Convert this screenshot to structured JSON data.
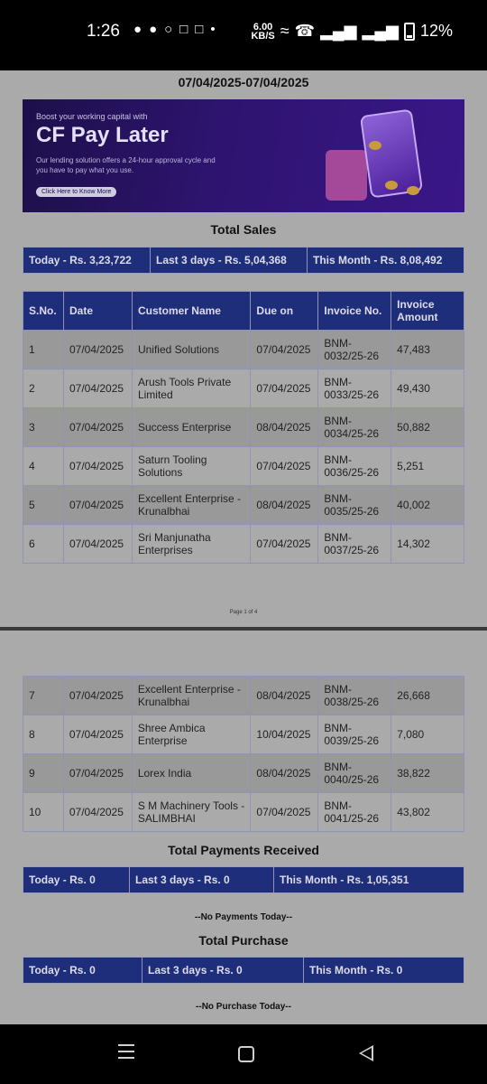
{
  "status_bar": {
    "time": "1:26",
    "net_speed": "6.00",
    "net_unit": "KB/S",
    "battery": "12%"
  },
  "report": {
    "date_range": "07/04/2025-07/04/2025"
  },
  "banner": {
    "subtitle": "Boost your working capital with",
    "title": "CF Pay Later",
    "description": "Our lending solution offers a 24-hour approval cycle and you have to pay what you use.",
    "button": "Click Here to Know More"
  },
  "sales": {
    "title": "Total Sales",
    "today": "Today - Rs. 3,23,722",
    "last3": "Last 3 days - Rs. 5,04,368",
    "month": "This Month - Rs. 8,08,492",
    "headers": [
      "S.No.",
      "Date",
      "Customer Name",
      "Due on",
      "Invoice No.",
      "Invoice Amount"
    ],
    "rows": [
      {
        "sno": "1",
        "date": "07/04/2025",
        "customer": "Unified Solutions",
        "due": "07/04/2025",
        "invoice": "BNM-0032/25-26",
        "amount": "47,483"
      },
      {
        "sno": "2",
        "date": "07/04/2025",
        "customer": "Arush Tools Private Limited",
        "due": "07/04/2025",
        "invoice": "BNM-0033/25-26",
        "amount": "49,430"
      },
      {
        "sno": "3",
        "date": "07/04/2025",
        "customer": "Success Enterprise",
        "due": "08/04/2025",
        "invoice": "BNM-0034/25-26",
        "amount": "50,882"
      },
      {
        "sno": "4",
        "date": "07/04/2025",
        "customer": "Saturn Tooling Solutions",
        "due": "07/04/2025",
        "invoice": "BNM-0036/25-26",
        "amount": "5,251"
      },
      {
        "sno": "5",
        "date": "07/04/2025",
        "customer": "Excellent Enterprise - Krunalbhai",
        "due": "08/04/2025",
        "invoice": "BNM-0035/25-26",
        "amount": "40,002"
      },
      {
        "sno": "6",
        "date": "07/04/2025",
        "customer": "Sri Manjunatha Enterprises",
        "due": "07/04/2025",
        "invoice": "BNM-0037/25-26",
        "amount": "14,302"
      },
      {
        "sno": "7",
        "date": "07/04/2025",
        "customer": "Excellent Enterprise - Krunalbhai",
        "due": "08/04/2025",
        "invoice": "BNM-0038/25-26",
        "amount": "26,668"
      },
      {
        "sno": "8",
        "date": "07/04/2025",
        "customer": "Shree Ambica Enterprise",
        "due": "10/04/2025",
        "invoice": "BNM-0039/25-26",
        "amount": "7,080"
      },
      {
        "sno": "9",
        "date": "07/04/2025",
        "customer": "Lorex India",
        "due": "08/04/2025",
        "invoice": "BNM-0040/25-26",
        "amount": "38,822"
      },
      {
        "sno": "10",
        "date": "07/04/2025",
        "customer": "S M Machinery Tools - SALIMBHAI",
        "due": "07/04/2025",
        "invoice": "BNM-0041/25-26",
        "amount": "43,802"
      }
    ]
  },
  "page_label": "Page 1 of 4",
  "payments": {
    "title": "Total Payments Received",
    "today": "Today - Rs. 0",
    "last3": "Last 3 days - Rs. 0",
    "month": "This Month - Rs. 1,05,351",
    "note": "--No Payments Today--"
  },
  "purchase": {
    "title": "Total Purchase",
    "today": "Today - Rs. 0",
    "last3": "Last 3 days - Rs. 0",
    "month": "This Month - Rs. 0",
    "note": "--No Purchase Today--"
  }
}
